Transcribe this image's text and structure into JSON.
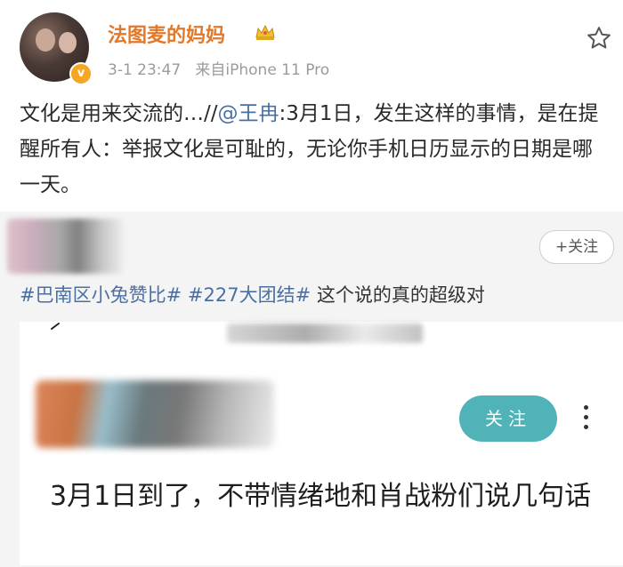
{
  "post": {
    "username": "法图麦的妈妈",
    "time": "3-1 23:47",
    "source": "来自iPhone 11 Pro",
    "text_before": "文化是用来交流的…//",
    "mention": "@王冉",
    "text_after": ":3月1日，发生这样的事情，是在提醒所有人：举报文化是可耻的，无论你手机日历显示的日期是哪一天。",
    "badge": "v"
  },
  "quoted": {
    "follow_label": "+关注",
    "hashtag1": "#巴南区小兔赞比#",
    "hashtag2": "#227大团结#",
    "comment": " 这个说的真的超级对"
  },
  "inner": {
    "follow_label": "关注",
    "text": "3月1日到了，不带情绪地和肖战粉们说几句话"
  },
  "icons": {
    "avatar": "user-avatar",
    "crown": "crown-icon",
    "star": "star-outline-icon",
    "back": "back-arrow-icon",
    "more": "more-vertical-icon"
  },
  "colors": {
    "username": "#e2782a",
    "link": "#4a6fa5",
    "teal_button": "#4fb3b8",
    "quote_bg": "#f4f4f4"
  }
}
